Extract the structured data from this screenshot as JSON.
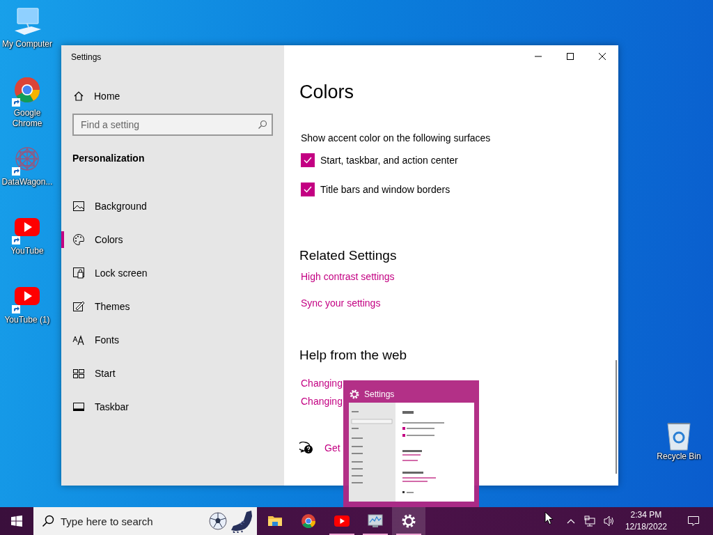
{
  "desktop_icons": [
    {
      "label": "My Computer",
      "kind": "computer",
      "shortcut": false
    },
    {
      "label": "Google Chrome",
      "kind": "chrome",
      "shortcut": true
    },
    {
      "label": "DataWagon...",
      "kind": "pattern",
      "shortcut": true
    },
    {
      "label": "YouTube",
      "kind": "youtube",
      "shortcut": true
    },
    {
      "label": "YouTube (1)",
      "kind": "youtube",
      "shortcut": true
    }
  ],
  "recycle_bin": {
    "label": "Recycle Bin"
  },
  "settings_window": {
    "title": "Settings",
    "sidebar": {
      "home": "Home",
      "search": {
        "placeholder": "Find a setting"
      },
      "section": "Personalization",
      "items": [
        {
          "label": "Background",
          "kind": "picture",
          "selected": false
        },
        {
          "label": "Colors",
          "kind": "palette",
          "selected": true
        },
        {
          "label": "Lock screen",
          "kind": "lock",
          "selected": false
        },
        {
          "label": "Themes",
          "kind": "brush",
          "selected": false
        },
        {
          "label": "Fonts",
          "kind": "fonts",
          "selected": false
        },
        {
          "label": "Start",
          "kind": "start",
          "selected": false
        },
        {
          "label": "Taskbar",
          "kind": "taskbar",
          "selected": false
        }
      ]
    },
    "content": {
      "title": "Colors",
      "accent_label": "Show accent color on the following surfaces",
      "checkboxes": [
        {
          "label": "Start, taskbar, and action center",
          "checked": true
        },
        {
          "label": "Title bars and window borders",
          "checked": true
        }
      ],
      "related_heading": "Related Settings",
      "related_links": [
        "High contrast settings",
        "Sync your settings"
      ],
      "help_heading": "Help from the web",
      "help_links": [
        "Changing",
        "Changing"
      ],
      "get_help": "Get"
    }
  },
  "thumbnail": {
    "title": "Settings"
  },
  "taskbar": {
    "search": {
      "placeholder": "Type here to search"
    },
    "apps": [
      {
        "kind": "explorer",
        "running": false,
        "active": false
      },
      {
        "kind": "chrome",
        "running": false,
        "active": false
      },
      {
        "kind": "youtube",
        "running": true,
        "active": false
      },
      {
        "kind": "monitor",
        "running": true,
        "active": false
      },
      {
        "kind": "gear",
        "running": true,
        "active": true
      }
    ],
    "clock": {
      "time": "2:34 PM",
      "date": "12/18/2022"
    }
  }
}
